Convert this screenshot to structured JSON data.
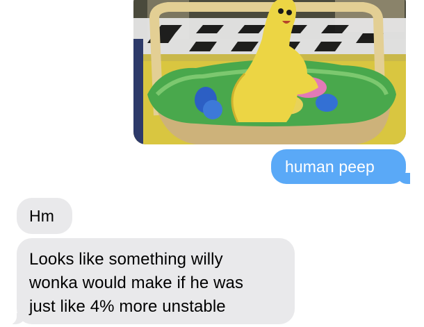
{
  "conversation": {
    "sent": {
      "photo_description": "photo-attachment",
      "text": "human peep"
    },
    "received": [
      {
        "text": "Hm"
      },
      {
        "lines": [
          "Looks like something willy",
          "wonka would make if he was",
          "just like 4% more unstable"
        ]
      }
    ]
  },
  "colors": {
    "sent_bubble": "#5aa9f7",
    "received_bubble": "#e9e9eb",
    "background": "#ffffff"
  }
}
